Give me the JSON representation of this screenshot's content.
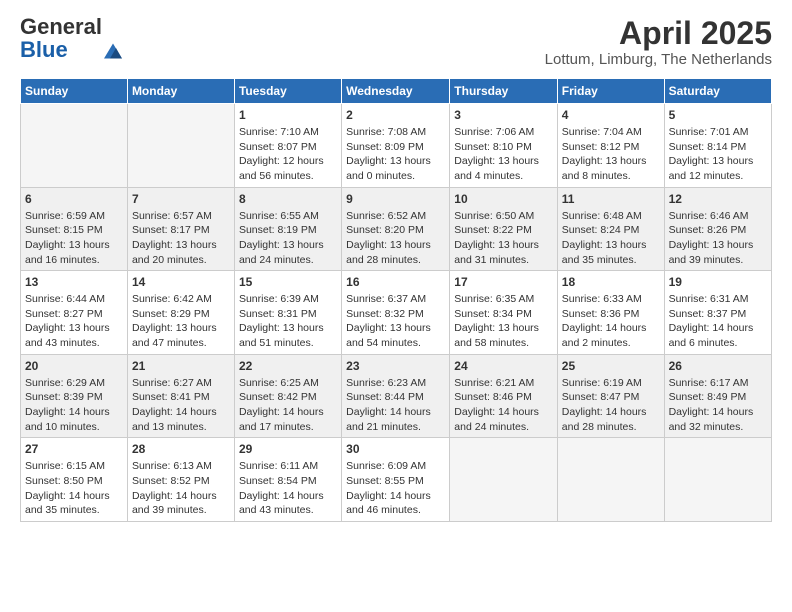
{
  "header": {
    "logo_general": "General",
    "logo_blue": "Blue",
    "title": "April 2025",
    "subtitle": "Lottum, Limburg, The Netherlands"
  },
  "days_of_week": [
    "Sunday",
    "Monday",
    "Tuesday",
    "Wednesday",
    "Thursday",
    "Friday",
    "Saturday"
  ],
  "weeks": [
    [
      {
        "day": "",
        "sunrise": "",
        "sunset": "",
        "daylight": ""
      },
      {
        "day": "",
        "sunrise": "",
        "sunset": "",
        "daylight": ""
      },
      {
        "day": "1",
        "sunrise": "Sunrise: 7:10 AM",
        "sunset": "Sunset: 8:07 PM",
        "daylight": "Daylight: 12 hours and 56 minutes."
      },
      {
        "day": "2",
        "sunrise": "Sunrise: 7:08 AM",
        "sunset": "Sunset: 8:09 PM",
        "daylight": "Daylight: 13 hours and 0 minutes."
      },
      {
        "day": "3",
        "sunrise": "Sunrise: 7:06 AM",
        "sunset": "Sunset: 8:10 PM",
        "daylight": "Daylight: 13 hours and 4 minutes."
      },
      {
        "day": "4",
        "sunrise": "Sunrise: 7:04 AM",
        "sunset": "Sunset: 8:12 PM",
        "daylight": "Daylight: 13 hours and 8 minutes."
      },
      {
        "day": "5",
        "sunrise": "Sunrise: 7:01 AM",
        "sunset": "Sunset: 8:14 PM",
        "daylight": "Daylight: 13 hours and 12 minutes."
      }
    ],
    [
      {
        "day": "6",
        "sunrise": "Sunrise: 6:59 AM",
        "sunset": "Sunset: 8:15 PM",
        "daylight": "Daylight: 13 hours and 16 minutes."
      },
      {
        "day": "7",
        "sunrise": "Sunrise: 6:57 AM",
        "sunset": "Sunset: 8:17 PM",
        "daylight": "Daylight: 13 hours and 20 minutes."
      },
      {
        "day": "8",
        "sunrise": "Sunrise: 6:55 AM",
        "sunset": "Sunset: 8:19 PM",
        "daylight": "Daylight: 13 hours and 24 minutes."
      },
      {
        "day": "9",
        "sunrise": "Sunrise: 6:52 AM",
        "sunset": "Sunset: 8:20 PM",
        "daylight": "Daylight: 13 hours and 28 minutes."
      },
      {
        "day": "10",
        "sunrise": "Sunrise: 6:50 AM",
        "sunset": "Sunset: 8:22 PM",
        "daylight": "Daylight: 13 hours and 31 minutes."
      },
      {
        "day": "11",
        "sunrise": "Sunrise: 6:48 AM",
        "sunset": "Sunset: 8:24 PM",
        "daylight": "Daylight: 13 hours and 35 minutes."
      },
      {
        "day": "12",
        "sunrise": "Sunrise: 6:46 AM",
        "sunset": "Sunset: 8:26 PM",
        "daylight": "Daylight: 13 hours and 39 minutes."
      }
    ],
    [
      {
        "day": "13",
        "sunrise": "Sunrise: 6:44 AM",
        "sunset": "Sunset: 8:27 PM",
        "daylight": "Daylight: 13 hours and 43 minutes."
      },
      {
        "day": "14",
        "sunrise": "Sunrise: 6:42 AM",
        "sunset": "Sunset: 8:29 PM",
        "daylight": "Daylight: 13 hours and 47 minutes."
      },
      {
        "day": "15",
        "sunrise": "Sunrise: 6:39 AM",
        "sunset": "Sunset: 8:31 PM",
        "daylight": "Daylight: 13 hours and 51 minutes."
      },
      {
        "day": "16",
        "sunrise": "Sunrise: 6:37 AM",
        "sunset": "Sunset: 8:32 PM",
        "daylight": "Daylight: 13 hours and 54 minutes."
      },
      {
        "day": "17",
        "sunrise": "Sunrise: 6:35 AM",
        "sunset": "Sunset: 8:34 PM",
        "daylight": "Daylight: 13 hours and 58 minutes."
      },
      {
        "day": "18",
        "sunrise": "Sunrise: 6:33 AM",
        "sunset": "Sunset: 8:36 PM",
        "daylight": "Daylight: 14 hours and 2 minutes."
      },
      {
        "day": "19",
        "sunrise": "Sunrise: 6:31 AM",
        "sunset": "Sunset: 8:37 PM",
        "daylight": "Daylight: 14 hours and 6 minutes."
      }
    ],
    [
      {
        "day": "20",
        "sunrise": "Sunrise: 6:29 AM",
        "sunset": "Sunset: 8:39 PM",
        "daylight": "Daylight: 14 hours and 10 minutes."
      },
      {
        "day": "21",
        "sunrise": "Sunrise: 6:27 AM",
        "sunset": "Sunset: 8:41 PM",
        "daylight": "Daylight: 14 hours and 13 minutes."
      },
      {
        "day": "22",
        "sunrise": "Sunrise: 6:25 AM",
        "sunset": "Sunset: 8:42 PM",
        "daylight": "Daylight: 14 hours and 17 minutes."
      },
      {
        "day": "23",
        "sunrise": "Sunrise: 6:23 AM",
        "sunset": "Sunset: 8:44 PM",
        "daylight": "Daylight: 14 hours and 21 minutes."
      },
      {
        "day": "24",
        "sunrise": "Sunrise: 6:21 AM",
        "sunset": "Sunset: 8:46 PM",
        "daylight": "Daylight: 14 hours and 24 minutes."
      },
      {
        "day": "25",
        "sunrise": "Sunrise: 6:19 AM",
        "sunset": "Sunset: 8:47 PM",
        "daylight": "Daylight: 14 hours and 28 minutes."
      },
      {
        "day": "26",
        "sunrise": "Sunrise: 6:17 AM",
        "sunset": "Sunset: 8:49 PM",
        "daylight": "Daylight: 14 hours and 32 minutes."
      }
    ],
    [
      {
        "day": "27",
        "sunrise": "Sunrise: 6:15 AM",
        "sunset": "Sunset: 8:50 PM",
        "daylight": "Daylight: 14 hours and 35 minutes."
      },
      {
        "day": "28",
        "sunrise": "Sunrise: 6:13 AM",
        "sunset": "Sunset: 8:52 PM",
        "daylight": "Daylight: 14 hours and 39 minutes."
      },
      {
        "day": "29",
        "sunrise": "Sunrise: 6:11 AM",
        "sunset": "Sunset: 8:54 PM",
        "daylight": "Daylight: 14 hours and 43 minutes."
      },
      {
        "day": "30",
        "sunrise": "Sunrise: 6:09 AM",
        "sunset": "Sunset: 8:55 PM",
        "daylight": "Daylight: 14 hours and 46 minutes."
      },
      {
        "day": "",
        "sunrise": "",
        "sunset": "",
        "daylight": ""
      },
      {
        "day": "",
        "sunrise": "",
        "sunset": "",
        "daylight": ""
      },
      {
        "day": "",
        "sunrise": "",
        "sunset": "",
        "daylight": ""
      }
    ]
  ]
}
